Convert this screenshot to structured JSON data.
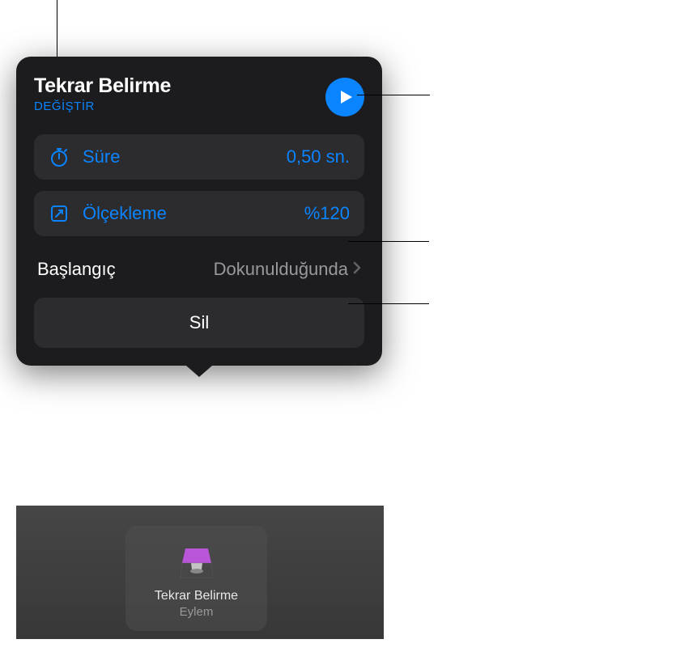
{
  "popover": {
    "title": "Tekrar Belirme",
    "change_label": "DEĞİŞTİR",
    "duration": {
      "label": "Süre",
      "value": "0,50 sn."
    },
    "scale": {
      "label": "Ölçekleme",
      "value": "%120"
    },
    "start": {
      "label": "Başlangıç",
      "value": "Dokunulduğunda"
    },
    "delete_label": "Sil"
  },
  "thumbnail": {
    "title": "Tekrar Belirme",
    "subtitle": "Eylem"
  }
}
